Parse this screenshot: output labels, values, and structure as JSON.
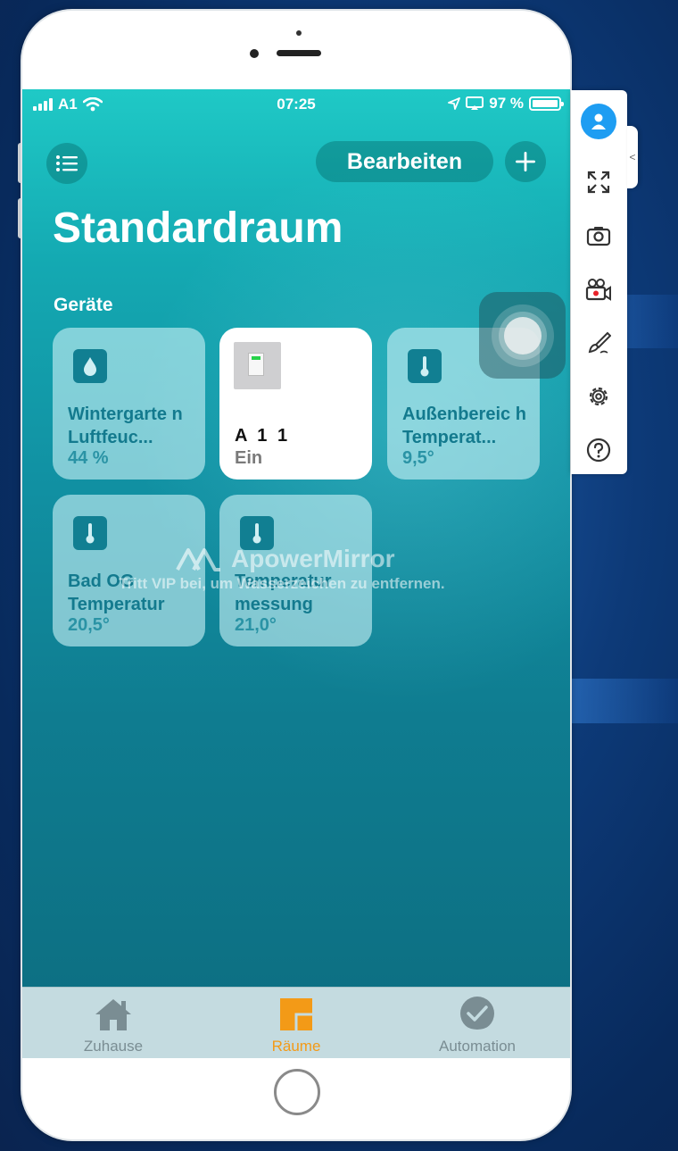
{
  "status_bar": {
    "carrier": "A1",
    "time": "07:25",
    "battery": "97 %"
  },
  "header": {
    "edit_label": "Bearbeiten",
    "room_title": "Standardraum",
    "section_label": "Geräte"
  },
  "tiles": [
    {
      "name": "Wintergarte n Luftfeuc...",
      "value": "44 %",
      "icon": "drop-icon",
      "on": false
    },
    {
      "name": "A 1 1",
      "value": "Ein",
      "icon": "switch-icon",
      "on": true
    },
    {
      "name": "Außenbereic h Temperat...",
      "value": "9,5°",
      "icon": "thermometer-icon",
      "on": false
    },
    {
      "name": "Bad OG Temperatur",
      "value": "20,5°",
      "icon": "thermometer-icon",
      "on": false
    },
    {
      "name": "Temperatur messung",
      "value": "21,0°",
      "icon": "thermometer-icon",
      "on": false
    }
  ],
  "watermark": {
    "brand": "ApowerMirror",
    "subtitle": "Tritt VIP bei, um Wasserzeichen zu entfernen."
  },
  "tabbar": {
    "tabs": [
      {
        "label": "Zuhause",
        "icon": "house-icon",
        "active": false
      },
      {
        "label": "Räume",
        "icon": "rooms-icon",
        "active": true
      },
      {
        "label": "Automation",
        "icon": "automation-icon",
        "active": false
      }
    ]
  },
  "side_toolbar": {
    "icons": [
      "user-icon",
      "fullscreen-icon",
      "screenshot-icon",
      "record-icon",
      "brush-icon",
      "settings-icon",
      "help-icon"
    ],
    "collapse_glyph": "<"
  },
  "colors": {
    "accent_active_tab": "#f39a17",
    "tile_icon": "#117f92",
    "user_badge": "#1e9df2"
  }
}
